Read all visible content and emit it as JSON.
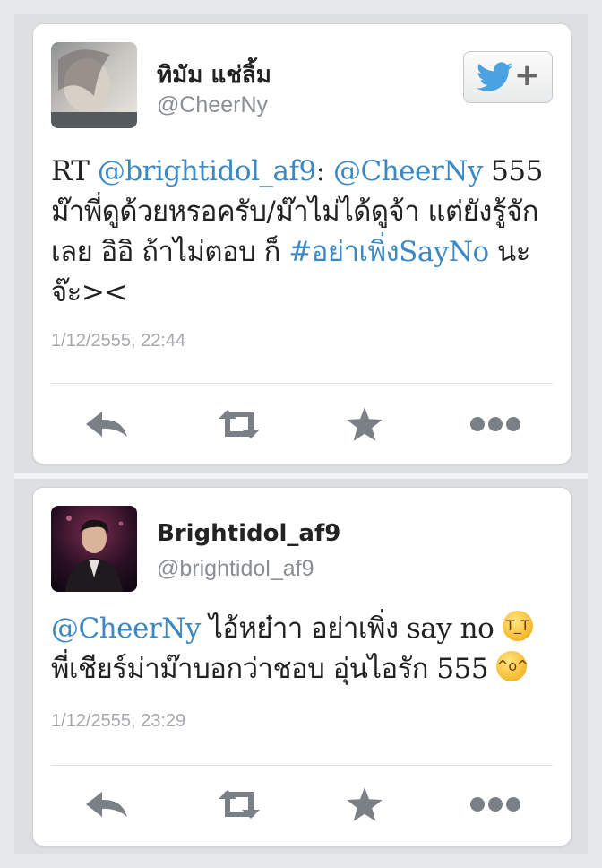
{
  "tweets": [
    {
      "name": "ทิมัม แช่ลิ้ม",
      "handle": "@CheerNy",
      "text": {
        "p1": "RT ",
        "l1": "@brightidol_af9",
        "p2": ": ",
        "l2": "@CheerNy",
        "p3": " 555 ม๊าพี่ดูด้วยหรอครับ/ม๊าไม่ได้ดูจ้า แต่ยังรู้จักเลย อิอิ ถ้าไม่ตอบ ก็ ",
        "l3": "#อย่าเพิ่งSayNo",
        "p4": " นะจ๊ะ><"
      },
      "timestamp": "1/12/2555, 22:44"
    },
    {
      "name": "Brightidol_af9",
      "handle": "@brightidol_af9",
      "text": {
        "l1": "@CheerNy",
        "p1": " ไอ้หย๋าา อย่าเพิ่ง say no ",
        "p2": "พี่เชียร์ม่าม๊าบอกว่าชอบ อุ่นไอรัก 555 "
      },
      "timestamp": "1/12/2555, 23:29"
    }
  ],
  "actions": [
    "reply",
    "retweet",
    "favorite",
    "more"
  ],
  "follow_button": {
    "plus": "+"
  },
  "colors": {
    "link": "#3b88c3",
    "twitter_blue": "#4aa3e0",
    "icon_gray": "#7b8086"
  },
  "icons": [
    "reply-icon",
    "retweet-icon",
    "star-icon",
    "more-icon",
    "twitter-bird-icon",
    "crying-emoji-icon",
    "laughing-emoji-icon"
  ]
}
